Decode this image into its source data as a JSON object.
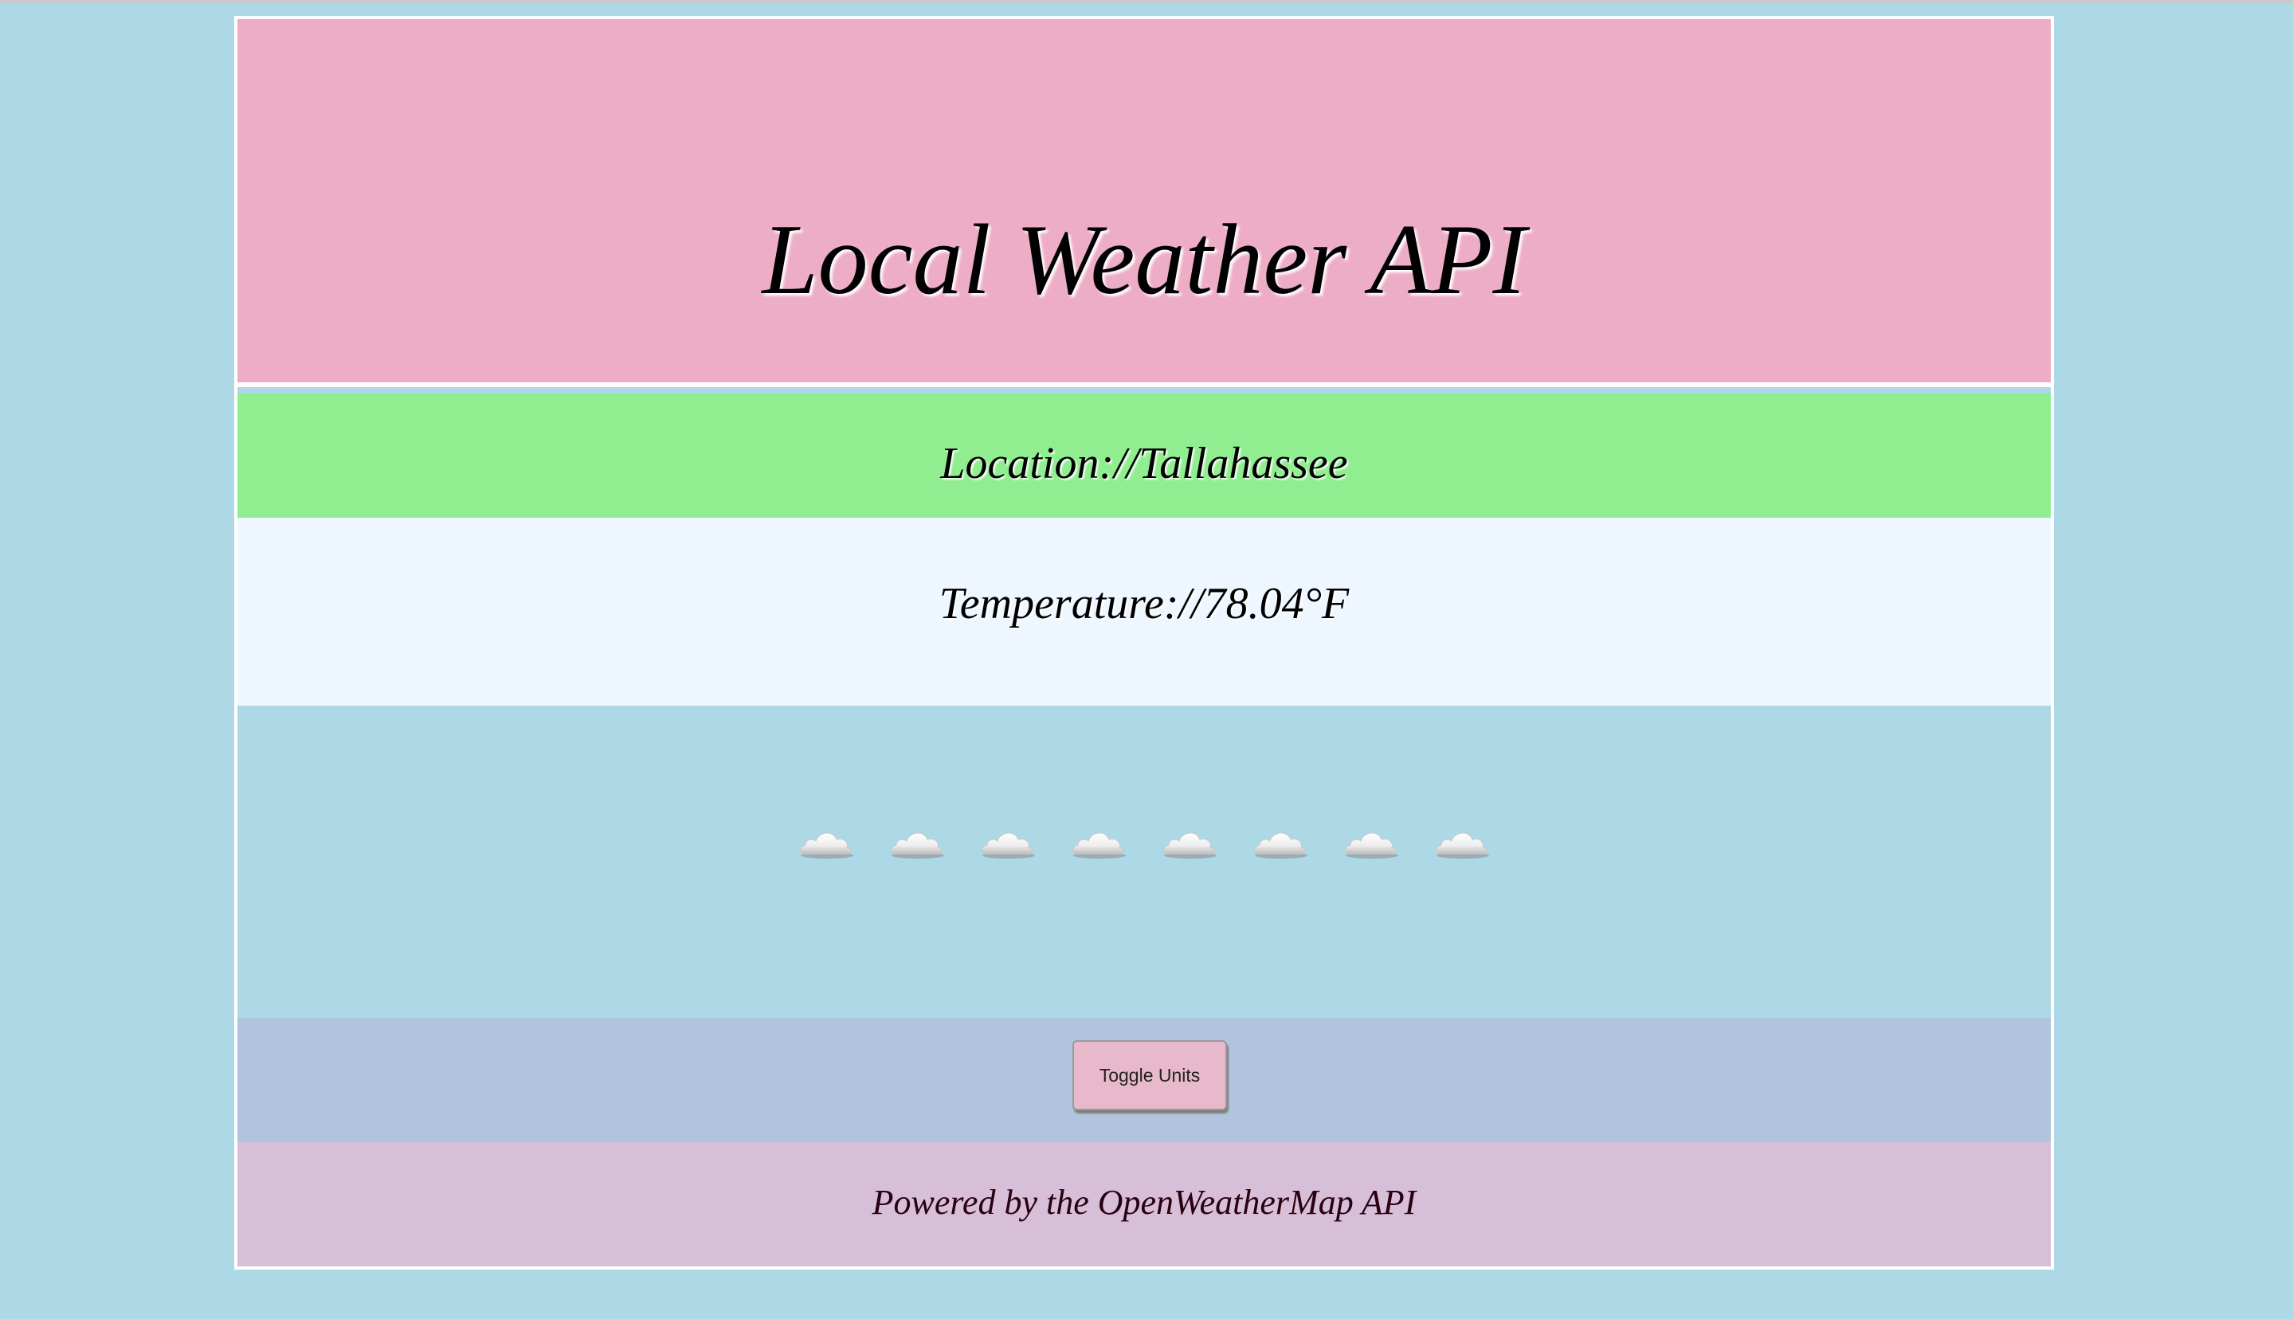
{
  "header": {
    "title": "Local Weather API"
  },
  "location": {
    "text": "Location://Tallahassee"
  },
  "temperature": {
    "text": "Temperature://78.04°F"
  },
  "weather_icons": {
    "icon": "cloud-icon",
    "count": 8
  },
  "controls": {
    "toggle_label": "Toggle Units"
  },
  "footer": {
    "text": "Powered by the OpenWeatherMap API"
  },
  "colors": {
    "page_background": "#add8e6",
    "header": "#edadc7",
    "location": "#90ee90",
    "temperature": "#eef7ff",
    "controls": "#b0c4de",
    "footer": "#d8bfd8",
    "button": "#e8b8cb"
  }
}
